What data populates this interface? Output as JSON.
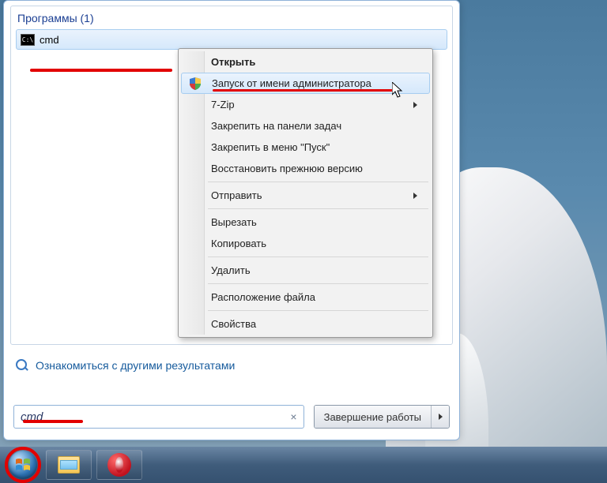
{
  "start_menu": {
    "section_header": "Программы (1)",
    "result_label": "cmd",
    "see_more": "Ознакомиться с другими результатами",
    "search_value": "cmd",
    "shutdown_label": "Завершение работы"
  },
  "context_menu": {
    "open": "Открыть",
    "run_as_admin": "Запуск от имени администратора",
    "seven_zip": "7-Zip",
    "pin_taskbar": "Закрепить на панели задач",
    "pin_start": "Закрепить в меню \"Пуск\"",
    "restore_prev": "Восстановить прежнюю версию",
    "send_to": "Отправить",
    "cut": "Вырезать",
    "copy": "Копировать",
    "delete": "Удалить",
    "open_location": "Расположение файла",
    "properties": "Свойства"
  },
  "taskbar": {
    "start": "Пуск",
    "explorer": "Проводник",
    "opera": "Opera"
  }
}
